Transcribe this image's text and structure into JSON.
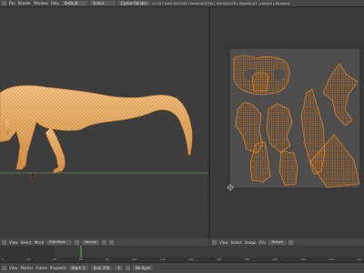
{
  "topbar": {
    "menu": [
      "File",
      "Render",
      "Window",
      "Help"
    ],
    "layout": "Default",
    "scene": "Scene",
    "engine": "Cycles Render",
    "info": "v2.70 | Verts:0/12345 | Faces:0/12345 | Tris:0/24578 | Objects:1/1 | Lamp:0 | Dinosaur"
  },
  "view3d_header": {
    "view": "View",
    "select": "Select",
    "mesh": "Mesh",
    "mode": "Edit Mode",
    "shading": "Normal"
  },
  "uv_header": {
    "view": "View",
    "select": "Select",
    "image": "Image",
    "uvs": "UVs",
    "image_name": "Texture"
  },
  "timeline": {
    "marker": "Marker",
    "frame": "Frame",
    "playback": "Playback",
    "start": "Start: 1",
    "end": "End: 250",
    "current": "1",
    "sync": "No Sync",
    "frames": [
      "0",
      "20",
      "40",
      "60",
      "80",
      "100",
      "120",
      "140",
      "160",
      "180",
      "200",
      "220",
      "240",
      "260"
    ]
  },
  "colors": {
    "accent": "#f0922b",
    "mesh": "#e7a961",
    "uv": "#ff7a00"
  }
}
